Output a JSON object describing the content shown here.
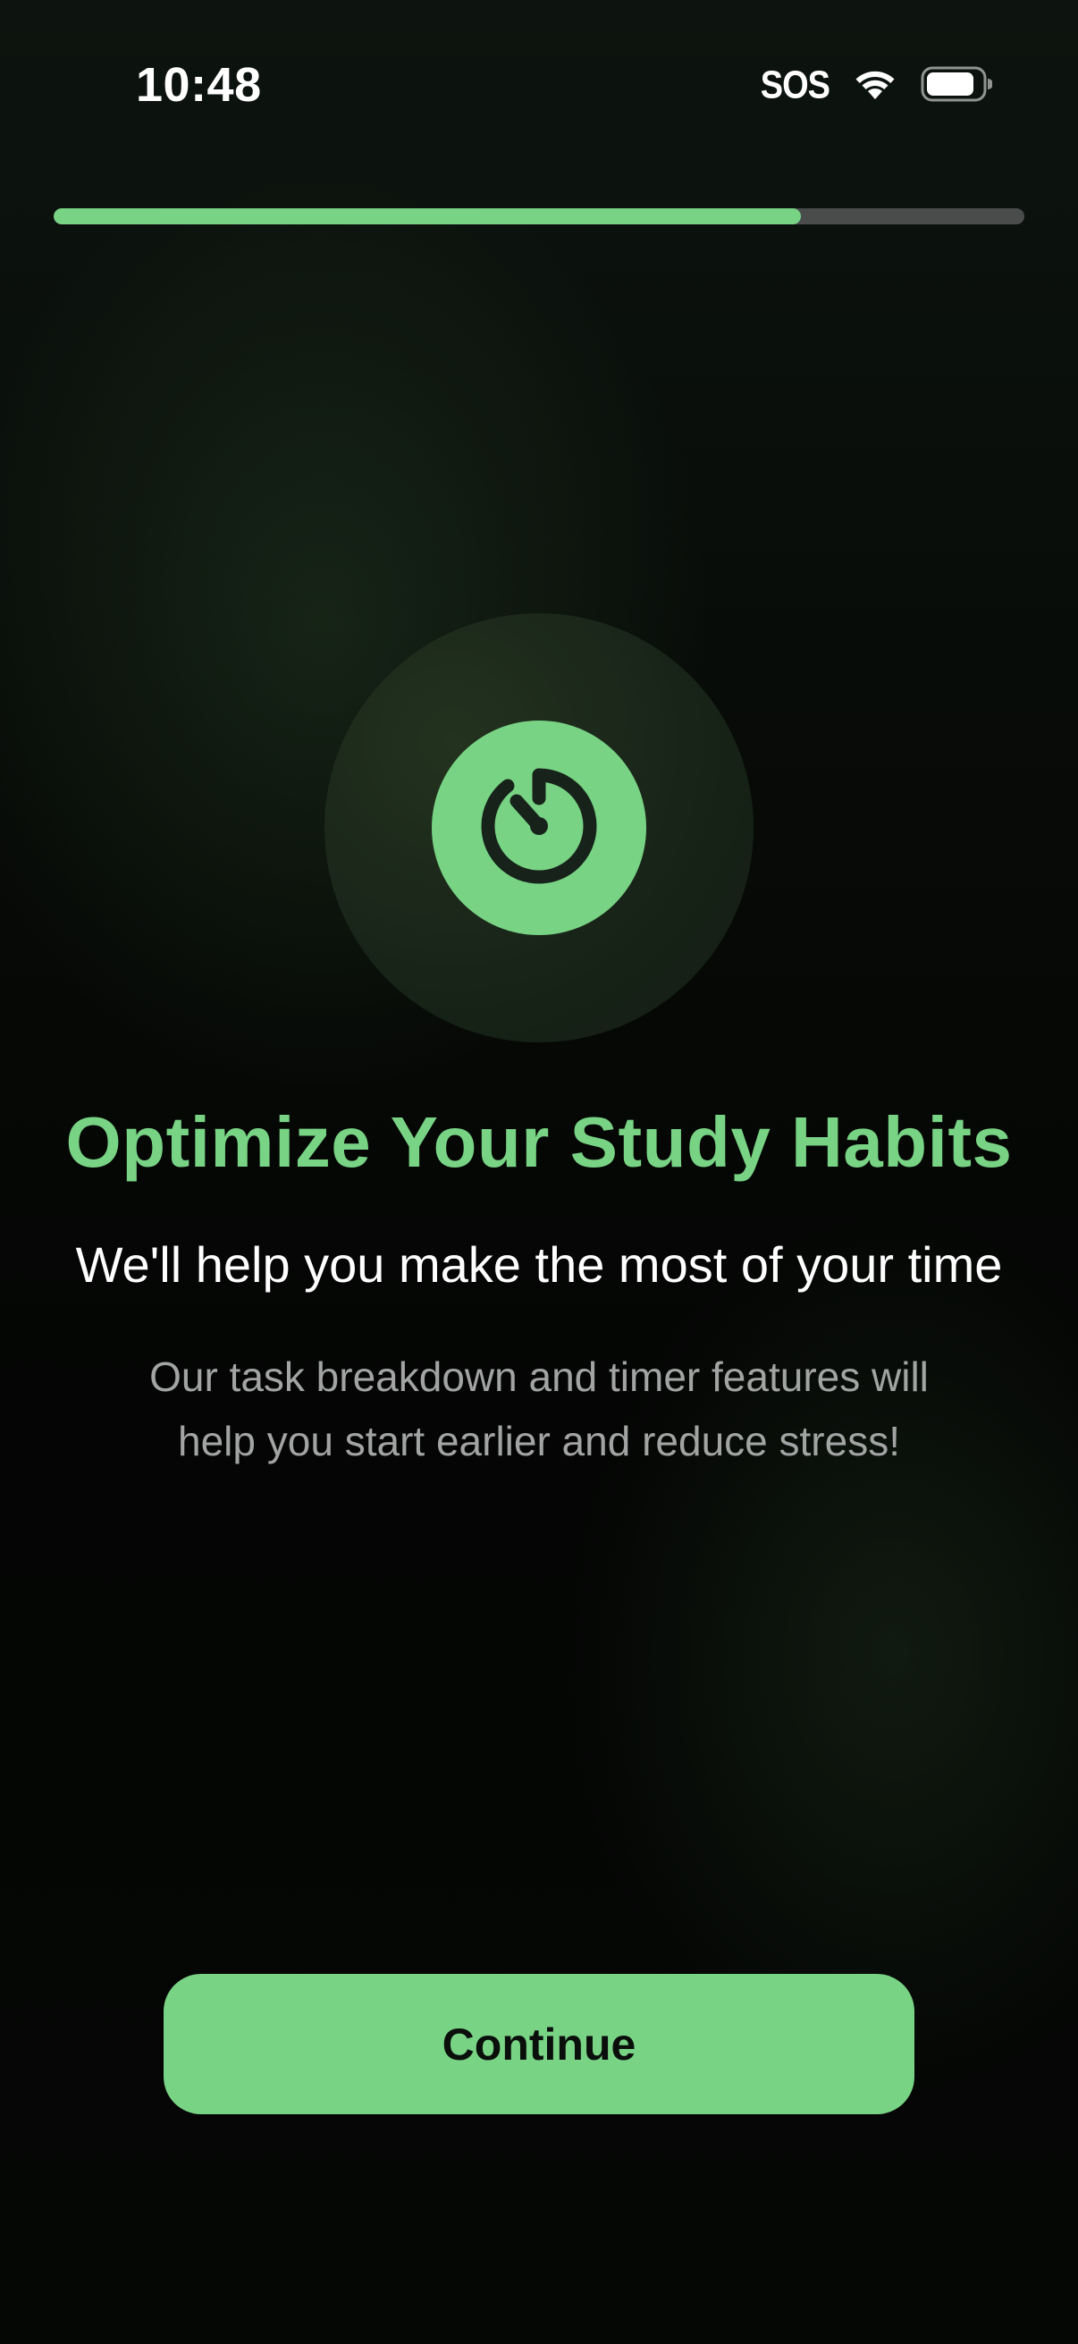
{
  "status_bar": {
    "time": "10:48",
    "sos_label": "SOS",
    "icons": [
      "wifi-icon",
      "battery-icon"
    ]
  },
  "progress": {
    "value": 0.77
  },
  "hero": {
    "icon": "timer-icon",
    "title": "Optimize Your Study Habits",
    "subtitle": "We'll help you make the most of your time",
    "body": "Our task breakdown and timer features will help you start earlier and reduce stress!"
  },
  "actions": {
    "continue_label": "Continue"
  },
  "colors": {
    "accent": "#78d384",
    "background": "#050705",
    "progress_track": "#4a4c4b",
    "body_text": "#a2a4a3"
  }
}
